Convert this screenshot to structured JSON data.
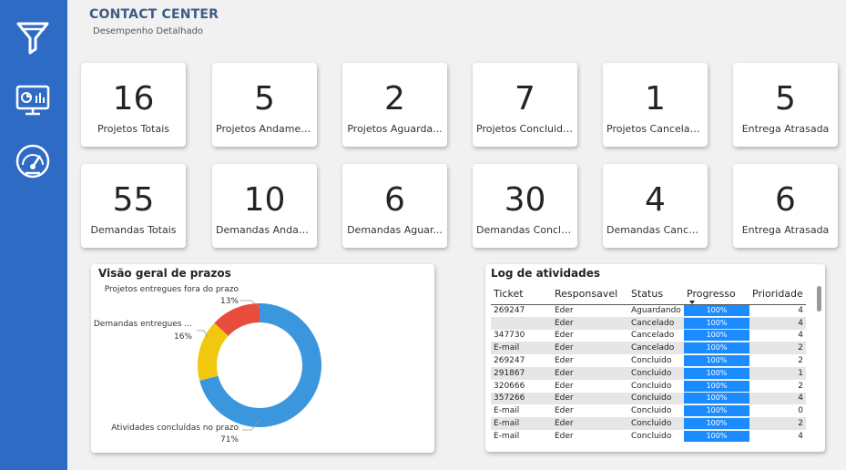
{
  "header": {
    "title": "CONTACT CENTER",
    "subtitle": "Desempenho Detalhado"
  },
  "sidebar": {
    "icons": [
      "filter-icon",
      "dashboard-icon",
      "gauge-icon"
    ]
  },
  "kpis_row1": [
    {
      "value": "16",
      "label": "Projetos Totais"
    },
    {
      "value": "5",
      "label": "Projetos Andamen..."
    },
    {
      "value": "2",
      "label": "Projetos Aguarda..."
    },
    {
      "value": "7",
      "label": "Projetos Concluidos"
    },
    {
      "value": "1",
      "label": "Projetos Cancelad..."
    },
    {
      "value": "5",
      "label": "Entrega Atrasada"
    }
  ],
  "kpis_row2": [
    {
      "value": "55",
      "label": "Demandas Totais"
    },
    {
      "value": "10",
      "label": "Demandas Andam..."
    },
    {
      "value": "6",
      "label": "Demandas Aguar..."
    },
    {
      "value": "30",
      "label": "Demandas Conclu..."
    },
    {
      "value": "4",
      "label": "Demandas Cancel..."
    },
    {
      "value": "6",
      "label": "Entrega Atrasada"
    }
  ],
  "overview": {
    "title": "Visão geral de prazos",
    "labels": {
      "fora_prazo": "Projetos entregues fora do prazo",
      "fora_prazo_pct": "13%",
      "demandas": "Demandas entregues ...",
      "demandas_pct": "16%",
      "concluidas": "Atividades concluídas no prazo",
      "concluidas_pct": "71%"
    }
  },
  "chart_data": {
    "type": "pie",
    "donut": true,
    "categories": [
      "Atividades concluídas no prazo",
      "Demandas entregues ...",
      "Projetos entregues fora do prazo"
    ],
    "values": [
      71,
      16,
      13
    ],
    "colors": [
      "#3a96dd",
      "#f2c80f",
      "#e84c3d"
    ]
  },
  "log": {
    "title": "Log de atividades",
    "columns": [
      "Ticket",
      "Responsavel",
      "Status",
      "Progresso",
      "Prioridade"
    ],
    "rows": [
      [
        "269247",
        "Eder",
        "Aguardando",
        "100%",
        "4"
      ],
      [
        "",
        "Eder",
        "Cancelado",
        "100%",
        "4"
      ],
      [
        "347730",
        "Eder",
        "Cancelado",
        "100%",
        "4"
      ],
      [
        "E-mail",
        "Eder",
        "Cancelado",
        "100%",
        "2"
      ],
      [
        "269247",
        "Eder",
        "Concluido",
        "100%",
        "2"
      ],
      [
        "291867",
        "Eder",
        "Concluido",
        "100%",
        "1"
      ],
      [
        "320666",
        "Eder",
        "Concluido",
        "100%",
        "2"
      ],
      [
        "357266",
        "Eder",
        "Concluido",
        "100%",
        "4"
      ],
      [
        "E-mail",
        "Eder",
        "Concluido",
        "100%",
        "0"
      ],
      [
        "E-mail",
        "Eder",
        "Concluido",
        "100%",
        "2"
      ],
      [
        "E-mail",
        "Eder",
        "Concluido",
        "100%",
        "4"
      ]
    ]
  }
}
